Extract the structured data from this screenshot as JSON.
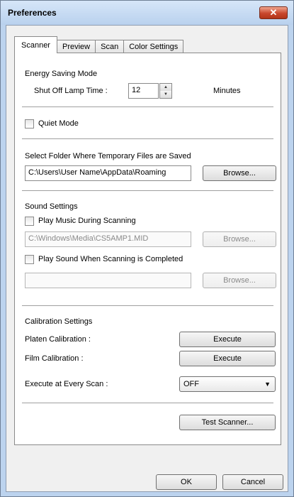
{
  "window": {
    "title": "Preferences",
    "close_icon": "close-icon"
  },
  "tabs": [
    {
      "label": "Scanner",
      "active": true
    },
    {
      "label": "Preview",
      "active": false
    },
    {
      "label": "Scan",
      "active": false
    },
    {
      "label": "Color Settings",
      "active": false
    }
  ],
  "energy": {
    "heading": "Energy Saving Mode",
    "lamp_label": "Shut Off Lamp Time :",
    "lamp_value": "12",
    "unit": "Minutes"
  },
  "quiet": {
    "label": "Quiet Mode",
    "checked": false
  },
  "temp_folder": {
    "heading": "Select Folder Where Temporary Files are Saved",
    "path": "C:\\Users\\User Name\\AppData\\Roaming",
    "browse": "Browse..."
  },
  "sound": {
    "heading": "Sound Settings",
    "play_music_label": "Play Music During Scanning",
    "play_music_checked": false,
    "music_path": "C:\\Windows\\Media\\CS5AMP1.MID",
    "browse1": "Browse...",
    "play_sound_label": "Play Sound When Scanning is Completed",
    "play_sound_checked": false,
    "sound_path": "",
    "browse2": "Browse..."
  },
  "calibration": {
    "heading": "Calibration Settings",
    "platen_label": "Platen Calibration :",
    "platen_button": "Execute",
    "film_label": "Film Calibration :",
    "film_button": "Execute",
    "every_scan_label": "Execute at Every Scan :",
    "every_scan_value": "OFF"
  },
  "test_button": "Test Scanner...",
  "footer": {
    "ok": "OK",
    "cancel": "Cancel"
  }
}
